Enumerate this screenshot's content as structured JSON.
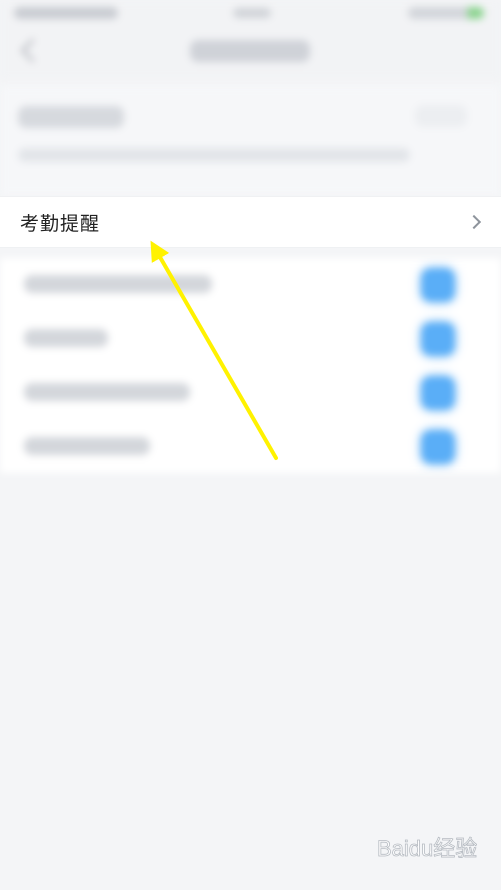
{
  "main_item": {
    "label": "考勤提醒",
    "icon": "chevron-right-icon"
  },
  "annotation": {
    "arrow_color": "#FFF200"
  },
  "watermark": {
    "text": "Baidu经验"
  }
}
